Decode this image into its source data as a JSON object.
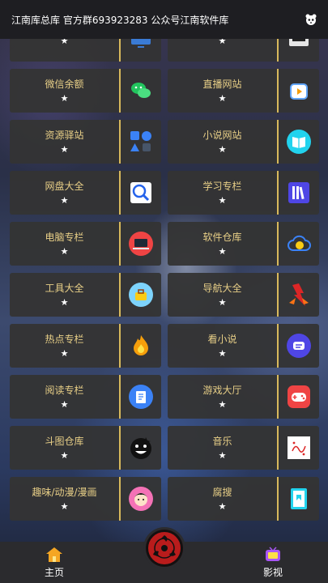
{
  "header": {
    "title": "江南库总库 官方群693923283 公众号江南软件库"
  },
  "cards": [
    {
      "label": "",
      "star": "★",
      "icon": "tv-icon",
      "color": "#3a7bd5"
    },
    {
      "label": "",
      "star": "★",
      "icon": "panel-icon",
      "color": "#dddddd"
    },
    {
      "label": "微信余额",
      "star": "★",
      "icon": "wechat-icon",
      "color": "#22c55e"
    },
    {
      "label": "直播网站",
      "star": "★",
      "icon": "live-icon",
      "color": "#f59e0b"
    },
    {
      "label": "资源驿站",
      "star": "★",
      "icon": "shapes-icon",
      "color": "#3b82f6"
    },
    {
      "label": "小说网站",
      "star": "★",
      "icon": "book-icon",
      "color": "#22d3ee"
    },
    {
      "label": "网盘大全",
      "star": "★",
      "icon": "search-disk-icon",
      "color": "#60a5fa"
    },
    {
      "label": "学习专栏",
      "star": "★",
      "icon": "books-shelf-icon",
      "color": "#6366f1"
    },
    {
      "label": "电脑专栏",
      "star": "★",
      "icon": "laptop-icon",
      "color": "#ef4444"
    },
    {
      "label": "软件仓库",
      "star": "★",
      "icon": "cloud-icon",
      "color": "#facc15"
    },
    {
      "label": "工具大全",
      "star": "★",
      "icon": "toolbox-icon",
      "color": "#7dd3fc"
    },
    {
      "label": "导航大全",
      "star": "★",
      "icon": "fire-bolt-icon",
      "color": "#ef4444"
    },
    {
      "label": "热点专栏",
      "star": "★",
      "icon": "flame-icon",
      "color": "#f59e0b"
    },
    {
      "label": "看小说",
      "star": "★",
      "icon": "chat-bubble-icon",
      "color": "#6366f1"
    },
    {
      "label": "阅读专栏",
      "star": "★",
      "icon": "document-icon",
      "color": "#3b82f6"
    },
    {
      "label": "游戏大厅",
      "star": "★",
      "icon": "gamepad-icon",
      "color": "#ef4444"
    },
    {
      "label": "斗图仓库",
      "star": "★",
      "icon": "face-icon",
      "color": "#111111"
    },
    {
      "label": "音乐",
      "star": "★",
      "icon": "music-sheet-icon",
      "color": "#ffffff"
    },
    {
      "label": "趣味/动漫/漫画",
      "star": "★",
      "icon": "cartoon-face-icon",
      "color": "#f472b6"
    },
    {
      "label": "腐搜",
      "star": "★",
      "icon": "bookmark-icon",
      "color": "#22d3ee"
    }
  ],
  "nav": {
    "home_label": "主页",
    "video_label": "影视"
  }
}
